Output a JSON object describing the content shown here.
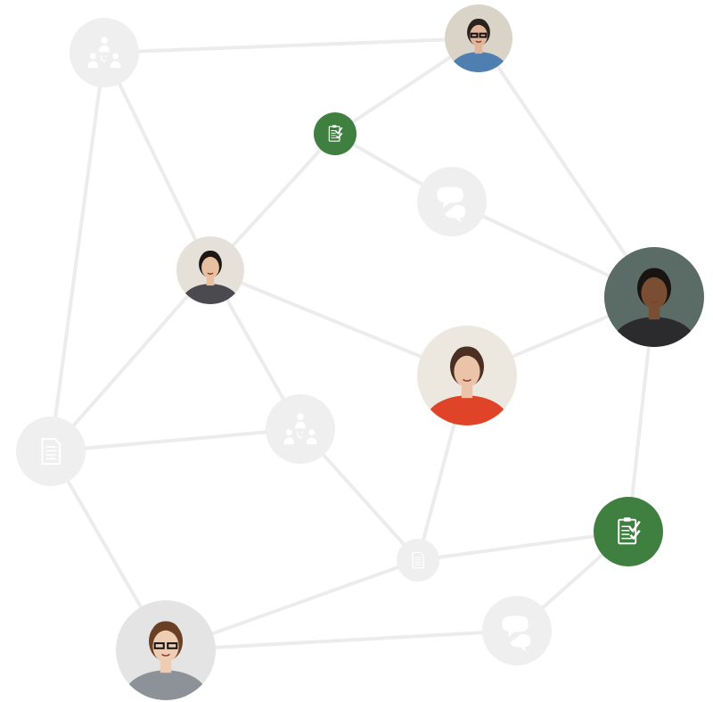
{
  "diagram": {
    "nodes": [
      {
        "id": "team-top-left",
        "kind": "team-icon"
      },
      {
        "id": "person-top",
        "kind": "person-photo",
        "person": "woman-headset",
        "skin": "#e2b49a",
        "hair": "#2b2220",
        "shirt": "#4f7fb0",
        "bg": "#d9d4c7"
      },
      {
        "id": "task-top",
        "kind": "task-icon",
        "accent": "#3f8040"
      },
      {
        "id": "chat-upper",
        "kind": "chat-icon"
      },
      {
        "id": "person-left",
        "kind": "person-photo",
        "person": "woman-smiling",
        "skin": "#e8c0a0",
        "hair": "#1c1815",
        "shirt": "#4a4a4f",
        "bg": "#e6e1d8"
      },
      {
        "id": "person-right",
        "kind": "person-photo",
        "person": "man-jacket",
        "skin": "#7a4e33",
        "hair": "#1a1410",
        "shirt": "#2b2b2e",
        "bg": "#5b6b66"
      },
      {
        "id": "person-center",
        "kind": "person-photo",
        "person": "woman-red-top",
        "skin": "#eac3a8",
        "hair": "#4b2f22",
        "shirt": "#e04428",
        "bg": "#ece7df"
      },
      {
        "id": "doc-left",
        "kind": "document-icon"
      },
      {
        "id": "team-center",
        "kind": "team-icon"
      },
      {
        "id": "doc-small",
        "kind": "document-icon"
      },
      {
        "id": "task-bottom-right",
        "kind": "task-icon",
        "accent": "#3f8040"
      },
      {
        "id": "person-bottom-left",
        "kind": "person-photo",
        "person": "man-glasses",
        "skin": "#efcdb3",
        "hair": "#6b3f24",
        "shirt": "#8c9297",
        "bg": "#e4e4e4"
      },
      {
        "id": "chat-bottom",
        "kind": "chat-icon"
      }
    ],
    "edges": [
      [
        "team-top-left",
        "person-top"
      ],
      [
        "team-top-left",
        "person-left"
      ],
      [
        "team-top-left",
        "doc-left"
      ],
      [
        "person-top",
        "task-top"
      ],
      [
        "person-top",
        "person-right"
      ],
      [
        "task-top",
        "chat-upper"
      ],
      [
        "task-top",
        "person-left"
      ],
      [
        "chat-upper",
        "person-right"
      ],
      [
        "person-left",
        "person-center"
      ],
      [
        "person-left",
        "doc-left"
      ],
      [
        "person-left",
        "team-center"
      ],
      [
        "person-center",
        "person-right"
      ],
      [
        "person-center",
        "doc-small"
      ],
      [
        "person-right",
        "task-bottom-right"
      ],
      [
        "doc-left",
        "team-center"
      ],
      [
        "doc-left",
        "person-bottom-left"
      ],
      [
        "team-center",
        "doc-small"
      ],
      [
        "doc-small",
        "task-bottom-right"
      ],
      [
        "doc-small",
        "person-bottom-left"
      ],
      [
        "task-bottom-right",
        "chat-bottom"
      ],
      [
        "person-bottom-left",
        "chat-bottom"
      ]
    ],
    "colors": {
      "edge": "#ececec",
      "icon_circle": "#efefef",
      "icon_glyph": "#ffffff",
      "task_green": "#3f8040"
    }
  }
}
